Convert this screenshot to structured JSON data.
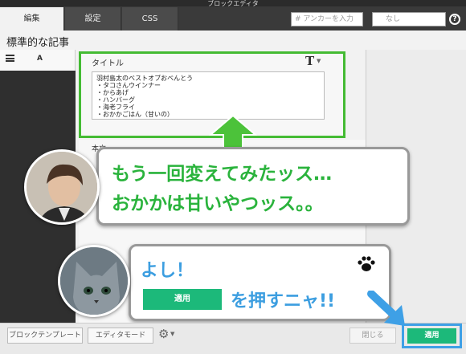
{
  "window": {
    "title": "ブロックエディタ"
  },
  "tabs": [
    {
      "label": "編集",
      "active": true
    },
    {
      "label": "設定",
      "active": false
    },
    {
      "label": "CSS",
      "active": false
    }
  ],
  "anchor": {
    "placeholder": "アンカーを入力"
  },
  "style_select": {
    "value": "なし"
  },
  "help": {
    "label": "?"
  },
  "page": {
    "heading": "標準的な記事"
  },
  "left_column": {
    "label": "A"
  },
  "title_block": {
    "label": "タイトル",
    "text": "羽村島太のベストオブおべんとう\n・タコさんウインナー\n・からあげ\n・ハンバーグ\n・海老フライ\n・おかかごはん（甘いの）"
  },
  "body_block": {
    "label": "本文"
  },
  "callout_1": {
    "line1": "もう一回変えてみたッス…",
    "line2": "おかかは甘いやつッス。。"
  },
  "callout_2": {
    "line1": "よし！",
    "apply_label": "適用",
    "line2": "を押すニャ!!"
  },
  "footer": {
    "block_template": "ブロックテンプレート",
    "editor_mode": "エディタモード",
    "close": "閉じる",
    "apply": "適用"
  },
  "colors": {
    "accent_green": "#1cb97a",
    "callout_green": "#2ab33c",
    "callout_blue": "#3c9ee0",
    "highlight_blue": "#3ea0e6"
  }
}
